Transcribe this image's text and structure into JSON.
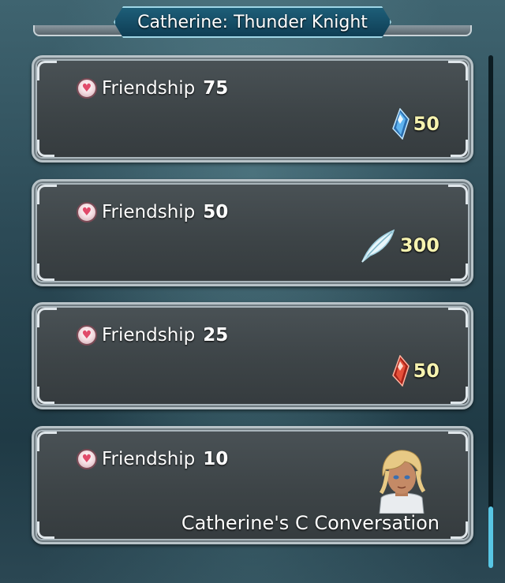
{
  "header": {
    "title": "Catherine: Thunder Knight"
  },
  "rewards": [
    {
      "requirement_label": "Friendship",
      "requirement_value": "75",
      "reward_icon": "blue-crystal-icon",
      "reward_amount": "50"
    },
    {
      "requirement_label": "Friendship",
      "requirement_value": "50",
      "reward_icon": "feather-icon",
      "reward_amount": "300"
    },
    {
      "requirement_label": "Friendship",
      "requirement_value": "25",
      "reward_icon": "red-crystal-icon",
      "reward_amount": "50"
    },
    {
      "requirement_label": "Friendship",
      "requirement_value": "10",
      "reward_icon": "character-portrait",
      "reward_text": "Catherine's C Conversation"
    }
  ],
  "colors": {
    "reward_text": "#f6f3b0",
    "scroll_thumb": "#58c6e4",
    "heart": "#e14a6a"
  }
}
